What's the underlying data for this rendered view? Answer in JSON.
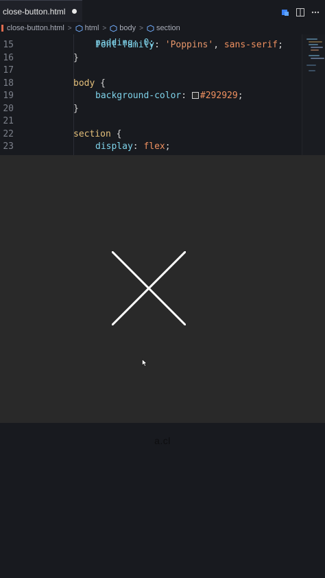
{
  "tab": {
    "title": "close-button.html"
  },
  "breadcrumb": [
    "close-button.html",
    "html",
    "body",
    "section"
  ],
  "code": {
    "partial_line": "padding: 0;",
    "lines": [
      {
        "n": "15",
        "indent": 2,
        "tokens": [
          [
            "prop",
            "font-family"
          ],
          [
            "punc",
            ": "
          ],
          [
            "str",
            "'Poppins'"
          ],
          [
            "punc",
            ", "
          ],
          [
            "val",
            "sans-serif"
          ],
          [
            "punc",
            ";"
          ]
        ]
      },
      {
        "n": "16",
        "indent": 1,
        "tokens": [
          [
            "punc",
            "}"
          ]
        ]
      },
      {
        "n": "17",
        "indent": 0,
        "tokens": []
      },
      {
        "n": "18",
        "indent": 1,
        "tokens": [
          [
            "sel",
            "body"
          ],
          [
            "punc",
            " {"
          ]
        ]
      },
      {
        "n": "19",
        "indent": 2,
        "tokens": [
          [
            "prop",
            "background-color"
          ],
          [
            "punc",
            ": "
          ],
          [
            "swatch",
            ""
          ],
          [
            "val",
            "#292929"
          ],
          [
            "punc",
            ";"
          ]
        ]
      },
      {
        "n": "20",
        "indent": 1,
        "tokens": [
          [
            "punc",
            "}"
          ]
        ]
      },
      {
        "n": "21",
        "indent": 0,
        "tokens": []
      },
      {
        "n": "22",
        "indent": 1,
        "tokens": [
          [
            "sel",
            "section"
          ],
          [
            "punc",
            " {"
          ]
        ]
      },
      {
        "n": "23",
        "indent": 2,
        "tokens": [
          [
            "prop",
            "display"
          ],
          [
            "punc",
            ": "
          ],
          [
            "val",
            "flex"
          ],
          [
            "punc",
            ";"
          ]
        ]
      }
    ]
  },
  "preview": {
    "background": "#292929",
    "icon": "close-x-icon"
  },
  "caption": "a.cl",
  "colors": {
    "editor_bg": "#181a1f",
    "selector": "#e5c07b",
    "property": "#7fd3ea",
    "value": "#f09160"
  }
}
